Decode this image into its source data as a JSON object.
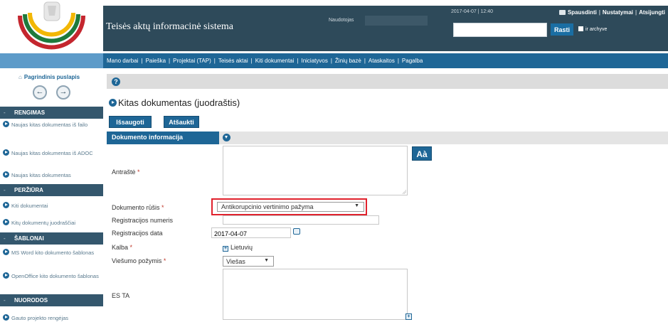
{
  "header": {
    "app_title": "Teisės aktų informacinė sistema",
    "user_label": "Naudotojas",
    "datetime": "2017-04-07 | 12:40",
    "links": [
      "Spausdinti",
      "Nustatymai",
      "Atsijungti"
    ],
    "search": {
      "value": "",
      "button": "Rasti",
      "archive_label": "ir archyve"
    }
  },
  "nav": [
    "Mano darbai",
    "Paieška",
    "Projektai (TAP)",
    "Teisės aktai",
    "Kiti dokumentai",
    "Iniciatyvos",
    "Žinių bazė",
    "Ataskaitos",
    "Pagalba"
  ],
  "sidebar": {
    "home": "Pagrindinis puslapis",
    "sections": [
      {
        "title": "RENGIMAS",
        "items": [
          "Naujas kitas dokumentas iš failo",
          "Naujas kitas dokumentas iš ADOC",
          "Naujas kitas dokumentas"
        ]
      },
      {
        "title": "PERŽIŪRA",
        "items": [
          "Kiti dokumentai",
          "Kitų dokumentų juodraščiai"
        ]
      },
      {
        "title": "ŠABLONAI",
        "items": [
          "MS Word kito dokumento šablonas",
          "OpenOffice kito dokumento šablonas"
        ]
      },
      {
        "title": "NUORODOS",
        "items": [
          "Gauto projekto rengėjas"
        ]
      }
    ]
  },
  "page": {
    "title": "Kitas dokumentas (juodraštis)",
    "save": "Išsaugoti",
    "cancel": "Atšaukti",
    "section": "Dokumento informacija",
    "aa": "Aà"
  },
  "form": {
    "antraste": {
      "label": "Antraštė",
      "value": ""
    },
    "rusis": {
      "label": "Dokumento rūšis",
      "value": "Antikorupcinio vertinimo pažyma"
    },
    "reg_nr": {
      "label": "Registracijos numeris",
      "value": ""
    },
    "reg_data": {
      "label": "Registracijos data",
      "value": "2017-04-07"
    },
    "kalba": {
      "label": "Kalba",
      "value": "Lietuvių"
    },
    "viesumas": {
      "label": "Viešumo požymis",
      "value": "Viešas"
    },
    "es_ta": {
      "label": "ES TA",
      "value": ""
    },
    "required_mark": "*"
  },
  "colors": {
    "header": "#2e4a5a",
    "nav": "#1e6696",
    "accent": "#1e6696",
    "highlight": "#e0212c"
  }
}
